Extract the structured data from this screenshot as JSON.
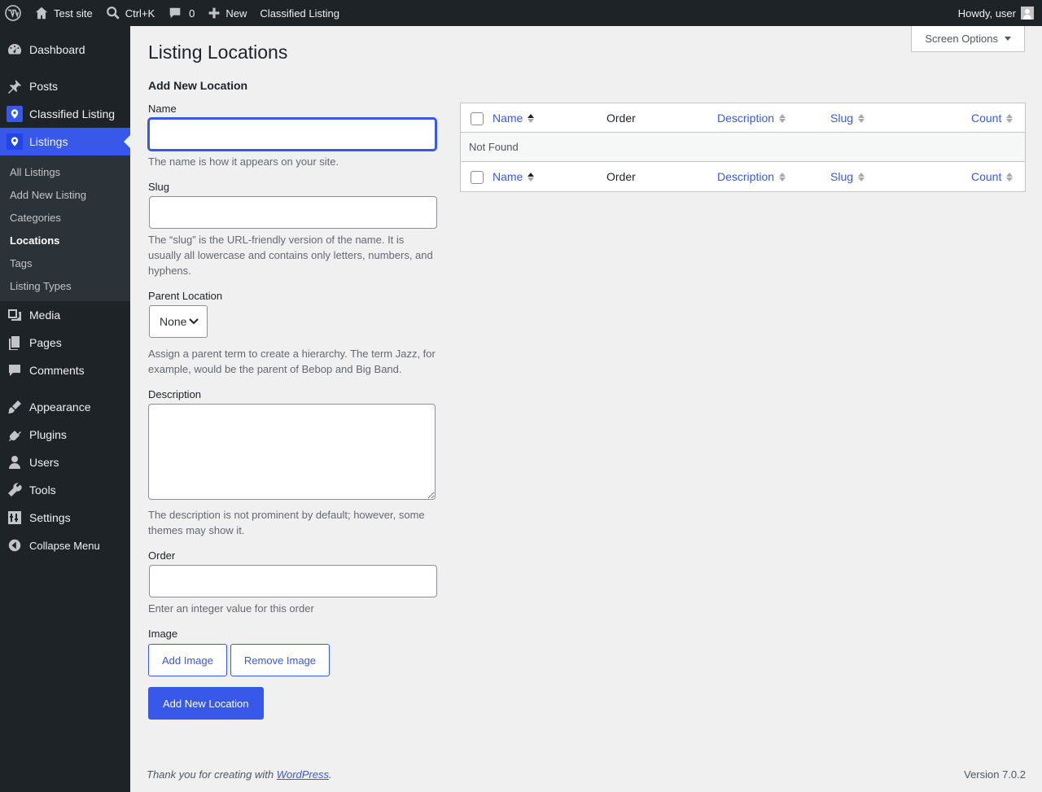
{
  "adminbar": {
    "site_name": "Test site",
    "search_shortcut": "Ctrl+K",
    "comments_count": "0",
    "new_label": "New",
    "plugin_link": "Classified Listing",
    "howdy": "Howdy, user"
  },
  "sidebar": {
    "dashboard": "Dashboard",
    "posts": "Posts",
    "classified": "Classified Listing",
    "listings": "Listings",
    "submenu": [
      "All Listings",
      "Add New Listing",
      "Categories",
      "Locations",
      "Tags",
      "Listing Types"
    ],
    "media": "Media",
    "pages": "Pages",
    "comments": "Comments",
    "appearance": "Appearance",
    "plugins": "Plugins",
    "users": "Users",
    "tools": "Tools",
    "settings": "Settings",
    "collapse": "Collapse Menu"
  },
  "screen_options": "Screen Options",
  "page_title": "Listing Locations",
  "form": {
    "heading": "Add New Location",
    "name_label": "Name",
    "name_value": "",
    "name_help": "The name is how it appears on your site.",
    "slug_label": "Slug",
    "slug_value": "",
    "slug_help": "The “slug” is the URL-friendly version of the name. It is usually all lowercase and contains only letters, numbers, and hyphens.",
    "parent_label": "Parent Location",
    "parent_value": "None",
    "parent_help": "Assign a parent term to create a hierarchy. The term Jazz, for example, would be the parent of Bebop and Big Band.",
    "description_label": "Description",
    "description_value": "",
    "description_help": "The description is not prominent by default; however, some themes may show it.",
    "order_label": "Order",
    "order_value": "",
    "order_help": "Enter an integer value for this order",
    "image_label": "Image",
    "add_image": "Add Image",
    "remove_image": "Remove Image",
    "submit": "Add New Location"
  },
  "table": {
    "columns": [
      "Name",
      "Order",
      "Description",
      "Slug",
      "Count"
    ],
    "empty_text": "Not Found"
  },
  "footer": {
    "thanks_prefix": "Thank you for creating with ",
    "thanks_link": "WordPress",
    "thanks_suffix": ".",
    "version": "Version 7.0.2"
  }
}
